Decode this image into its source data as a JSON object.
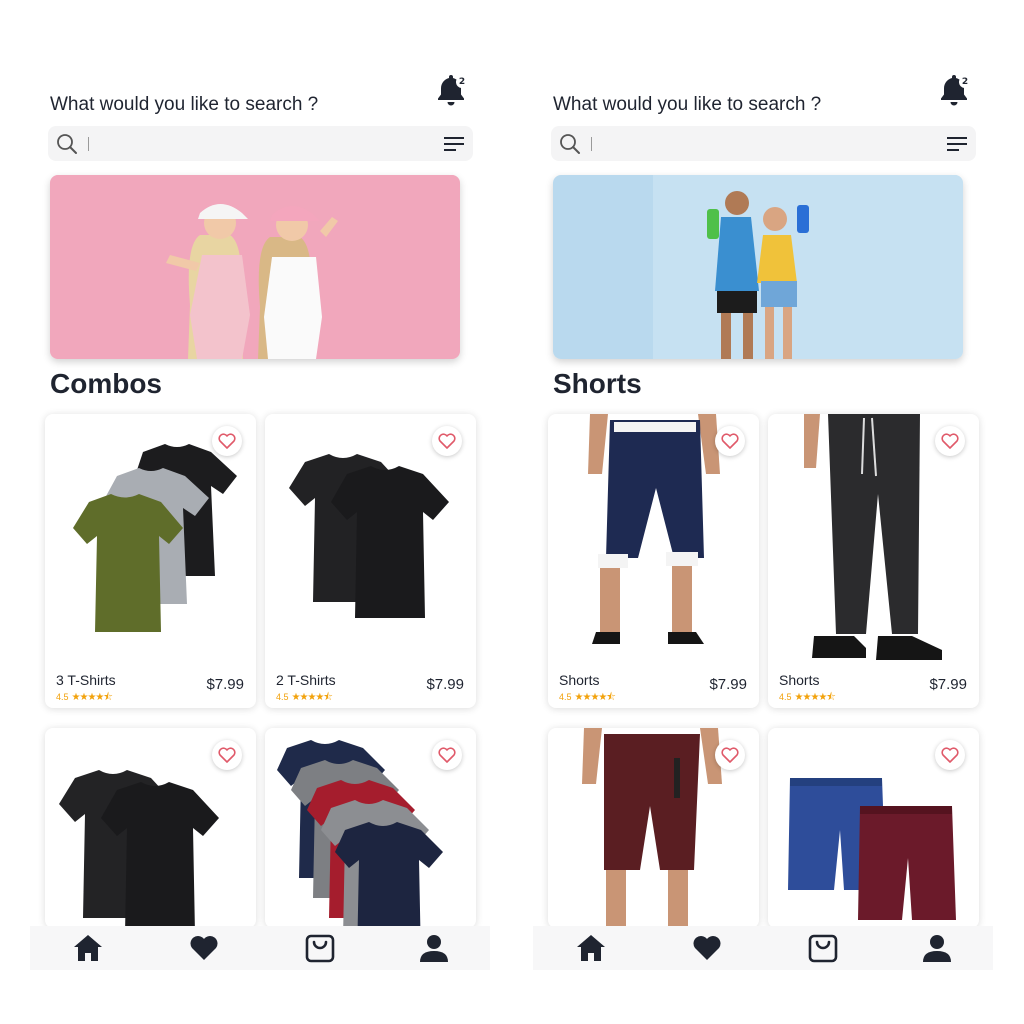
{
  "screens": [
    {
      "notification_count": "2",
      "prompt": "What would you like to search ?",
      "search": {
        "value": "",
        "placeholder": ""
      },
      "section_title": "Combos",
      "products": [
        {
          "name": "3 T-Shirts",
          "rating": "4.5",
          "price": "$7.99"
        },
        {
          "name": "2 T-Shirts",
          "rating": "4.5",
          "price": "$7.99"
        }
      ]
    },
    {
      "notification_count": "2",
      "prompt": "What would you like to search ?",
      "search": {
        "value": "",
        "placeholder": ""
      },
      "section_title": "Shorts",
      "products": [
        {
          "name": "Shorts",
          "rating": "4.5",
          "price": "$7.99"
        },
        {
          "name": "Shorts",
          "rating": "4.5",
          "price": "$7.99"
        }
      ]
    }
  ],
  "stars": "★★★★⯪",
  "icons": {
    "notification": "bell-icon",
    "search": "search-icon",
    "filter": "menu-lines-icon",
    "favorite": "heart-outline-icon",
    "nav": [
      "home-icon",
      "heart-icon",
      "shopping-bag-icon",
      "user-icon"
    ]
  },
  "colors": {
    "text": "#1f2430",
    "star": "#f2a20c",
    "heart": "#e05a6a",
    "search_bg": "#f4f4f5"
  }
}
